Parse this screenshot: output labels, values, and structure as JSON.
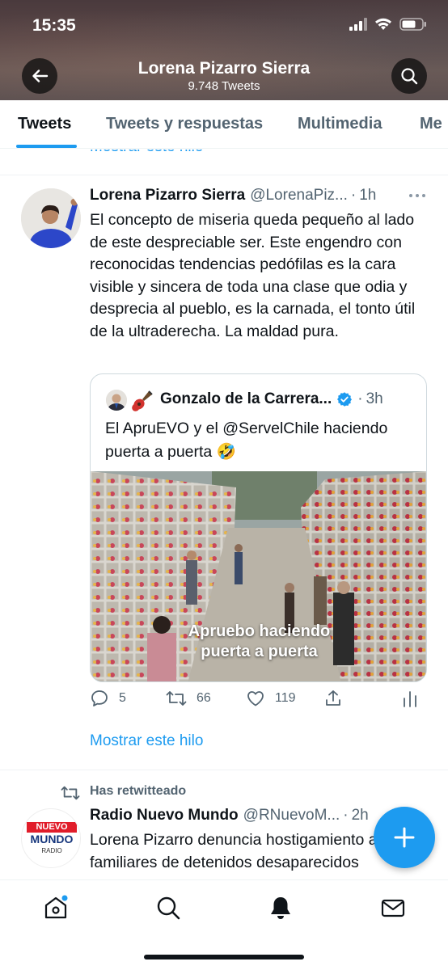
{
  "status_bar": {
    "time": "15:35"
  },
  "profile_header": {
    "name": "Lorena Pizarro Sierra",
    "tweet_count": "9.748 Tweets"
  },
  "tabs": [
    {
      "label": "Tweets",
      "active": true
    },
    {
      "label": "Tweets y respuestas",
      "active": false
    },
    {
      "label": "Multimedia",
      "active": false
    },
    {
      "label": "Me",
      "active": false
    }
  ],
  "show_thread_label": "Mostrar este hilo",
  "tweet": {
    "author_name": "Lorena Pizarro Sierra",
    "handle": "@LorenaPiz...",
    "time": "1h",
    "text": "El concepto de miseria queda pequeño al lado de este despreciable ser. Este engendro con reconocidas tendencias pedófilas es la cara visible y sincera de toda una clase que odia y desprecia al pueblo, es la carnada, el tonto útil de la ultraderecha. La maldad pura.",
    "quote": {
      "author_name": "Gonzalo de la Carrera...",
      "time": "3h",
      "text": "El ApruEVO y el @ServelChile haciendo puerta a puerta 🤣",
      "image_caption": "Apruebo haciendo puerta a puerta"
    },
    "stats": {
      "replies": "5",
      "retweets": "66",
      "likes": "119"
    }
  },
  "retweet": {
    "context": "Has retwitteado",
    "author_name": "Radio Nuevo Mundo",
    "handle": "@RNuevoM...",
    "time": "2h",
    "text": "Lorena Pizarro denuncia hostigamiento a familiares de detenidos desaparecidos",
    "logo": {
      "line1": "NUEVO",
      "line2": "MUNDO",
      "line3": "RADIO"
    }
  },
  "bottom_nav": [
    "home-icon",
    "search-icon",
    "notifications-icon",
    "messages-icon"
  ],
  "colors": {
    "accent": "#1d9bf0",
    "text": "#0f1419",
    "muted": "#536471"
  }
}
